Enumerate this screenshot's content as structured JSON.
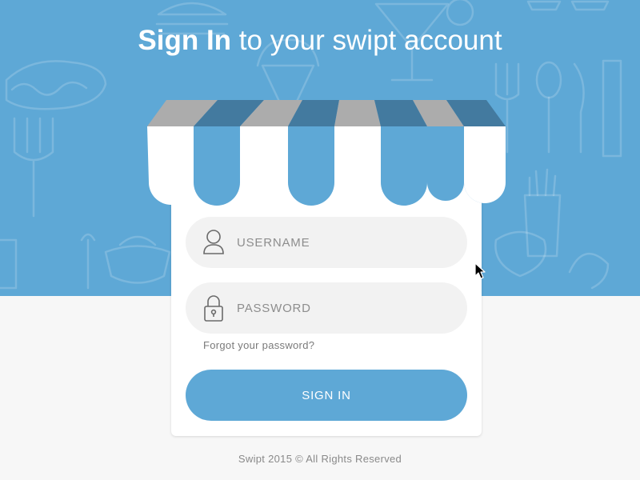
{
  "title": {
    "strong": "Sign In",
    "light": "to your swipt account"
  },
  "form": {
    "username": {
      "placeholder": "USERNAME",
      "value": "",
      "icon": "user-icon"
    },
    "password": {
      "placeholder": "PASSWORD",
      "value": "",
      "icon": "lock-icon"
    },
    "forgot_label": "Forgot your password?",
    "submit_label": "SIGN IN"
  },
  "footer": {
    "text": "Swipt 2015 © All Rights Reserved"
  },
  "colors": {
    "brand_blue": "#5ea8d6",
    "awning_dark_blue": "#437a9f",
    "awning_gray": "#acacac",
    "input_bg": "#f2f2f2",
    "page_bg": "#f7f7f7"
  }
}
